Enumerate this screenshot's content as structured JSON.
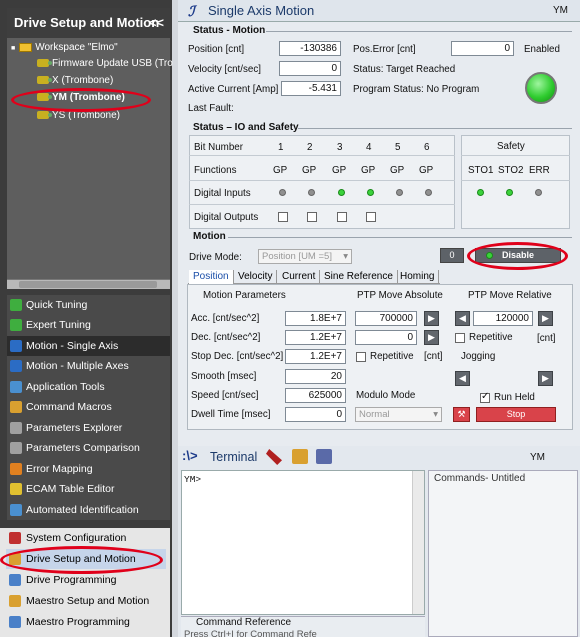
{
  "left": {
    "header": "Drive Setup and Motion",
    "header_chev": "<<",
    "tree": {
      "workspace": "Workspace \"Elmo\"",
      "items": [
        "Firmware Update USB (Tro",
        "X (Trombone)",
        "YM (Trombone)",
        "YS (Trombone)"
      ]
    },
    "nav": [
      "Quick Tuning",
      "Expert Tuning",
      "Motion - Single Axis",
      "Motion - Multiple Axes",
      "Application Tools",
      "Command Macros",
      "Parameters Explorer",
      "Parameters Comparison",
      "Error Mapping",
      "ECAM Table Editor",
      "Automated Identification"
    ],
    "nav2": [
      "System Configuration",
      "Drive Setup and Motion",
      "Drive Programming",
      "Maestro Setup and Motion",
      "Maestro Programming"
    ]
  },
  "header": {
    "title": "Single Axis Motion",
    "axis": "YM"
  },
  "status_motion": {
    "title": "Status - Motion",
    "position_label": "Position  [cnt]",
    "position": "-130386",
    "velocity_label": "Velocity  [cnt/sec]",
    "velocity": "0",
    "current_label": "Active Current [Amp]",
    "current": "-5.431",
    "fault_label": "Last Fault:",
    "pos_error_label": "Pos.Error  [cnt]",
    "pos_error": "0",
    "status_text": "Status: Target Reached",
    "program_text": "Program Status: No Program",
    "enabled_label": "Enabled"
  },
  "status_io": {
    "title": "Status – IO and Safety",
    "bit_label": "Bit Number",
    "bits": [
      "1",
      "2",
      "3",
      "4",
      "5",
      "6"
    ],
    "functions_label": "Functions",
    "functions": [
      "GP",
      "GP",
      "GP",
      "GP",
      "GP",
      "GP"
    ],
    "din_label": "Digital Inputs",
    "din": [
      false,
      false,
      true,
      true,
      false,
      false
    ],
    "dout_label": "Digital Outputs",
    "safety_title": "Safety",
    "safety_cols": [
      "STO1",
      "STO2",
      "ERR"
    ],
    "safety_state": [
      true,
      true,
      false
    ]
  },
  "motion": {
    "title": "Motion",
    "drive_mode_label": "Drive Mode:",
    "drive_mode": "Position [UM =5]",
    "zero_btn": "0",
    "disable_btn": "Disable",
    "tabs": [
      "Position",
      "Velocity",
      "Current",
      "Sine Reference",
      "Homing"
    ],
    "params_title": "Motion Parameters",
    "params": [
      {
        "label": "Acc. [cnt/sec^2]",
        "value": "1.8E+7"
      },
      {
        "label": "Dec. [cnt/sec^2]",
        "value": "1.2E+7"
      },
      {
        "label": "Stop Dec. [cnt/sec^2]",
        "value": "1.2E+7"
      },
      {
        "label": "Smooth [msec]",
        "value": "20"
      },
      {
        "label": "Speed [cnt/sec]",
        "value": "625000"
      },
      {
        "label": "Dwell Time [msec]",
        "value": "0"
      }
    ],
    "ptp_abs_title": "PTP Move Absolute",
    "ptp_abs_1": "700000",
    "ptp_abs_2": "0",
    "repetitive": "Repetitive",
    "cnt": "[cnt]",
    "modulo_title": "Modulo Mode",
    "modulo": "Normal",
    "ptp_rel_title": "PTP Move Relative",
    "ptp_rel": "120000",
    "repetitive2": "Repetitive",
    "cnt2": "[cnt]",
    "jogging": "Jogging",
    "run_held": "Run Held",
    "stop": "Stop"
  },
  "terminal": {
    "title": "Terminal",
    "axis": "YM",
    "prompt": "YM>",
    "commands": "Commands- Untitled",
    "cmd_ref": "Command Reference",
    "cmd_ref_sub": "Press Ctrl+I for Command Refe"
  },
  "colors": {
    "accent": "#1a4ea8",
    "led_on": "#3bd23b",
    "stop": "#d9434a",
    "highlight": "#e0001a"
  }
}
